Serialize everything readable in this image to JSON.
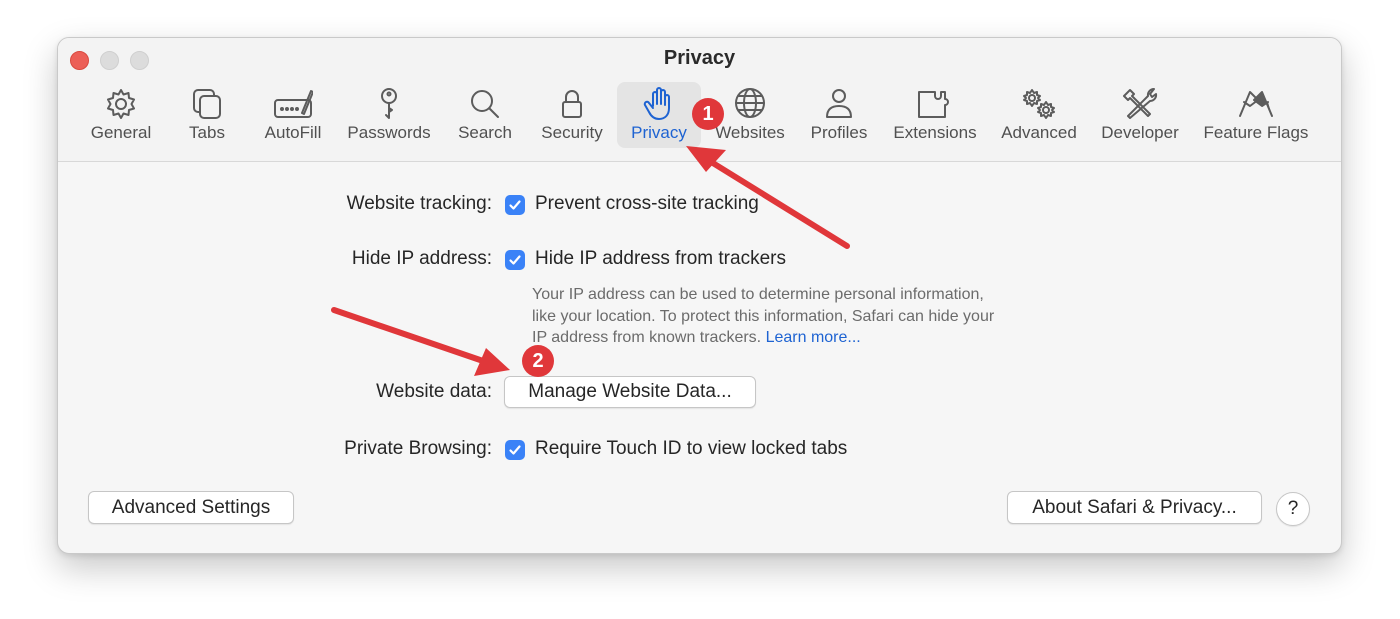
{
  "window": {
    "title": "Privacy"
  },
  "toolbar": {
    "tabs": [
      {
        "label": "General",
        "icon": "gear-icon"
      },
      {
        "label": "Tabs",
        "icon": "tabs-icon"
      },
      {
        "label": "AutoFill",
        "icon": "autofill-icon"
      },
      {
        "label": "Passwords",
        "icon": "key-icon"
      },
      {
        "label": "Search",
        "icon": "search-icon"
      },
      {
        "label": "Security",
        "icon": "lock-icon"
      },
      {
        "label": "Privacy",
        "icon": "hand-icon",
        "active": true
      },
      {
        "label": "Websites",
        "icon": "globe-icon"
      },
      {
        "label": "Profiles",
        "icon": "person-icon"
      },
      {
        "label": "Extensions",
        "icon": "puzzle-icon"
      },
      {
        "label": "Advanced",
        "icon": "gears-icon"
      },
      {
        "label": "Developer",
        "icon": "tools-icon"
      },
      {
        "label": "Feature Flags",
        "icon": "flags-icon"
      }
    ]
  },
  "settings": {
    "website_tracking": {
      "label": "Website tracking:",
      "option": "Prevent cross-site tracking",
      "checked": true
    },
    "hide_ip": {
      "label": "Hide IP address:",
      "option": "Hide IP address from trackers",
      "checked": true,
      "help_lines": [
        "Your IP address can be used to determine personal information,",
        "like your location. To protect this information, Safari can hide your",
        "IP address from known trackers."
      ],
      "help_link": "Learn more..."
    },
    "website_data": {
      "label": "Website data:",
      "button": "Manage Website Data..."
    },
    "private_browsing": {
      "label": "Private Browsing:",
      "option": "Require Touch ID to view locked tabs",
      "checked": true
    }
  },
  "footer": {
    "advanced_button": "Advanced Settings",
    "about_button": "About Safari & Privacy...",
    "help_button": "?"
  },
  "annotations": {
    "badge_1": "1",
    "badge_2": "2",
    "color": "#e0373a"
  },
  "colors": {
    "accent": "#1e63d2",
    "checkbox": "#3a82f7",
    "close": "#ec5f57"
  }
}
